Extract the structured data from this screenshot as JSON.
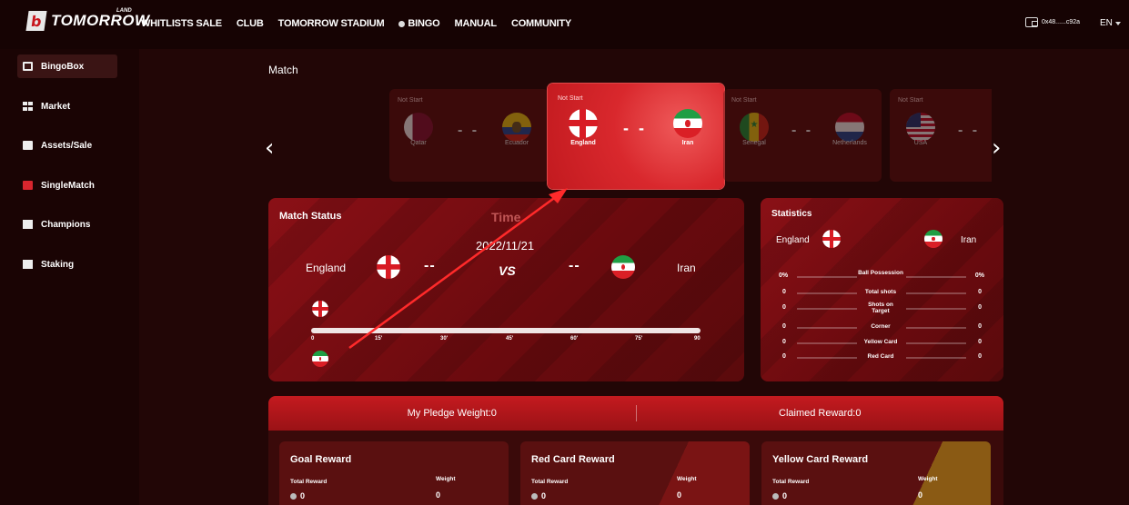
{
  "brand": {
    "sup": "LAND",
    "name": "TOMORROW"
  },
  "nav": [
    "WHITLISTS SALE",
    "CLUB",
    "TOMORROW STADIUM",
    "BINGO",
    "MANUAL",
    "COMMUNITY"
  ],
  "wallet": {
    "address": "0x48......c92a",
    "icon": "wallet-icon"
  },
  "lang": "EN",
  "sidebar": {
    "items": [
      {
        "label": "BingoBox",
        "icon": "box-icon",
        "active": true
      },
      {
        "label": "Market",
        "icon": "grid-icon",
        "active": false
      },
      {
        "label": "Assets/Sale",
        "icon": "assets-icon",
        "active": false
      },
      {
        "label": "SingleMatch",
        "icon": "single-match-icon",
        "active": false
      },
      {
        "label": "Champions",
        "icon": "champions-icon",
        "active": false
      },
      {
        "label": "Staking",
        "icon": "staking-icon",
        "active": false
      }
    ]
  },
  "match": {
    "title": "Match",
    "cards": [
      {
        "status": "Not Start",
        "home": "Qatar",
        "away": "Ecuador",
        "score": "- -"
      },
      {
        "status": "Not Start",
        "home": "England",
        "away": "Iran",
        "score": "- -"
      },
      {
        "status": "Not Start",
        "home": "Senegal",
        "away": "Netherlands",
        "score": "- -"
      },
      {
        "status": "Not Start",
        "home": "USA",
        "away": "",
        "score": "- -"
      }
    ]
  },
  "match_status": {
    "title": "Match Status",
    "time_label": "Time",
    "date": "2022/11/21",
    "home": "England",
    "away": "Iran",
    "home_score": "--",
    "away_score": "--",
    "vs": "VS",
    "ticks": [
      "0",
      "15'",
      "30'",
      "45'",
      "60'",
      "75'",
      "90"
    ]
  },
  "statistics": {
    "title": "Statistics",
    "home": "England",
    "away": "Iran",
    "rows": [
      {
        "label": "Ball Possession",
        "home": "0%",
        "away": "0%"
      },
      {
        "label": "Total shots",
        "home": "0",
        "away": "0"
      },
      {
        "label": "Shots on Target",
        "home": "0",
        "away": "0"
      },
      {
        "label": "Corner",
        "home": "0",
        "away": "0"
      },
      {
        "label": "Yellow Card",
        "home": "0",
        "away": "0"
      },
      {
        "label": "Red Card",
        "home": "0",
        "away": "0"
      }
    ]
  },
  "pledge": {
    "weight": "My Pledge Weight:0",
    "claimed": "Claimed Reward:0"
  },
  "rewards": [
    {
      "title": "Goal Reward",
      "total_label": "Total Reward",
      "total": "0",
      "weight_label": "Weight",
      "weight": "0"
    },
    {
      "title": "Red Card Reward",
      "total_label": "Total Reward",
      "total": "0",
      "weight_label": "Weight",
      "weight": "0"
    },
    {
      "title": "Yellow Card Reward",
      "total_label": "Total Reward",
      "total": "0",
      "weight_label": "Weight",
      "weight": "0"
    }
  ],
  "colors": {
    "accent": "#d9282d",
    "background": "#220606",
    "annotation_arrow": "#ff2a2a"
  }
}
